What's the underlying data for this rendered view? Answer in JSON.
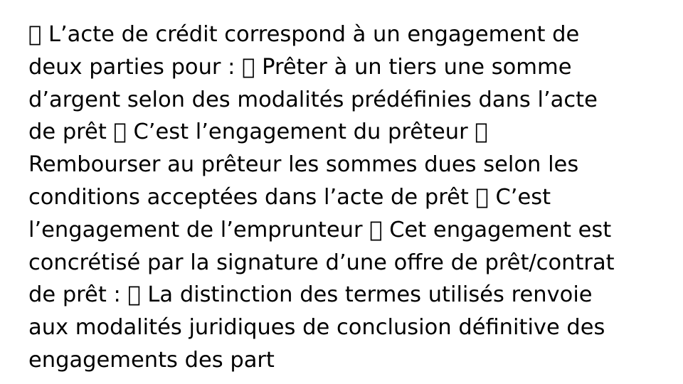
{
  "content": {
    "lines": [
      " L’acte de crédit correspond à un engagement de",
      "deux parties pour :  Prêter à un tiers une somme",
      "d’argent selon des modalités prédéfinies dans l’acte",
      "de prêt  C’est l’engagement du prêteur ",
      "Rembourser au prêteur les sommes dues selon les",
      "conditions acceptées dans l’acte de prêt  C’est",
      "l’engagement de l’emprunteur  Cet engagement est",
      "concrétisé par la signature d’une offre de prêt/contrat",
      "de prêt :  La distinction des termes utilisés renvoie",
      "aux modalités juridiques de conclusion définitive des",
      "engagements des part"
    ]
  }
}
